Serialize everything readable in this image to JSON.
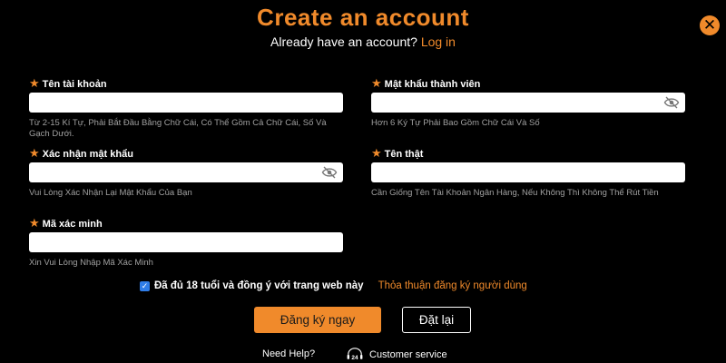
{
  "header": {
    "title": "Create an account",
    "subtitle_text": "Already have an account?",
    "login_link": "Log in"
  },
  "close": {
    "icon": "close-icon",
    "glyph": "✕"
  },
  "fields": [
    {
      "label": "Tên tài khoản",
      "value": "",
      "hint": "Từ 2-15 Kí Tự, Phải Bắt Đầu Bằng Chữ Cái, Có Thể Gồm Cả Chữ Cái, Số Và Gạch Dưới."
    },
    {
      "label": "Mật khẩu thành viên",
      "value": "",
      "hint": "Hơn 6 Ký Tự Phải Bao Gồm Chữ Cái Và Số",
      "icon": "eye-slash-icon"
    },
    {
      "label": "Xác nhận mật khẩu",
      "value": "",
      "hint": "Vui Lòng Xác Nhận Lại Mật Khẩu Của Bạn",
      "icon": "eye-slash-icon"
    },
    {
      "label": "Tên thật",
      "value": "",
      "hint": "Cần Giống Tên Tài Khoản Ngân Hàng, Nếu Không Thì Không Thể Rút Tiền"
    },
    {
      "label": "Mã xác minh",
      "value": "",
      "hint": "Xin Vui Lòng Nhập Mã Xác Minh"
    }
  ],
  "agreement": {
    "checked": true,
    "text": "Đã đủ 18 tuổi và đồng ý với trang web này",
    "terms_link": "Thỏa thuận đăng ký người dùng"
  },
  "buttons": {
    "register": "Đăng ký ngay",
    "reset": "Đặt lại"
  },
  "footer": {
    "help": "Need Help?",
    "service": "Customer service",
    "service_icon": "headset-24-icon",
    "service_icon_text": "24"
  },
  "colors": {
    "accent": "#f08a2b",
    "background": "#000000",
    "hint": "#a0a0a0",
    "checkbox": "#2f7de8"
  }
}
